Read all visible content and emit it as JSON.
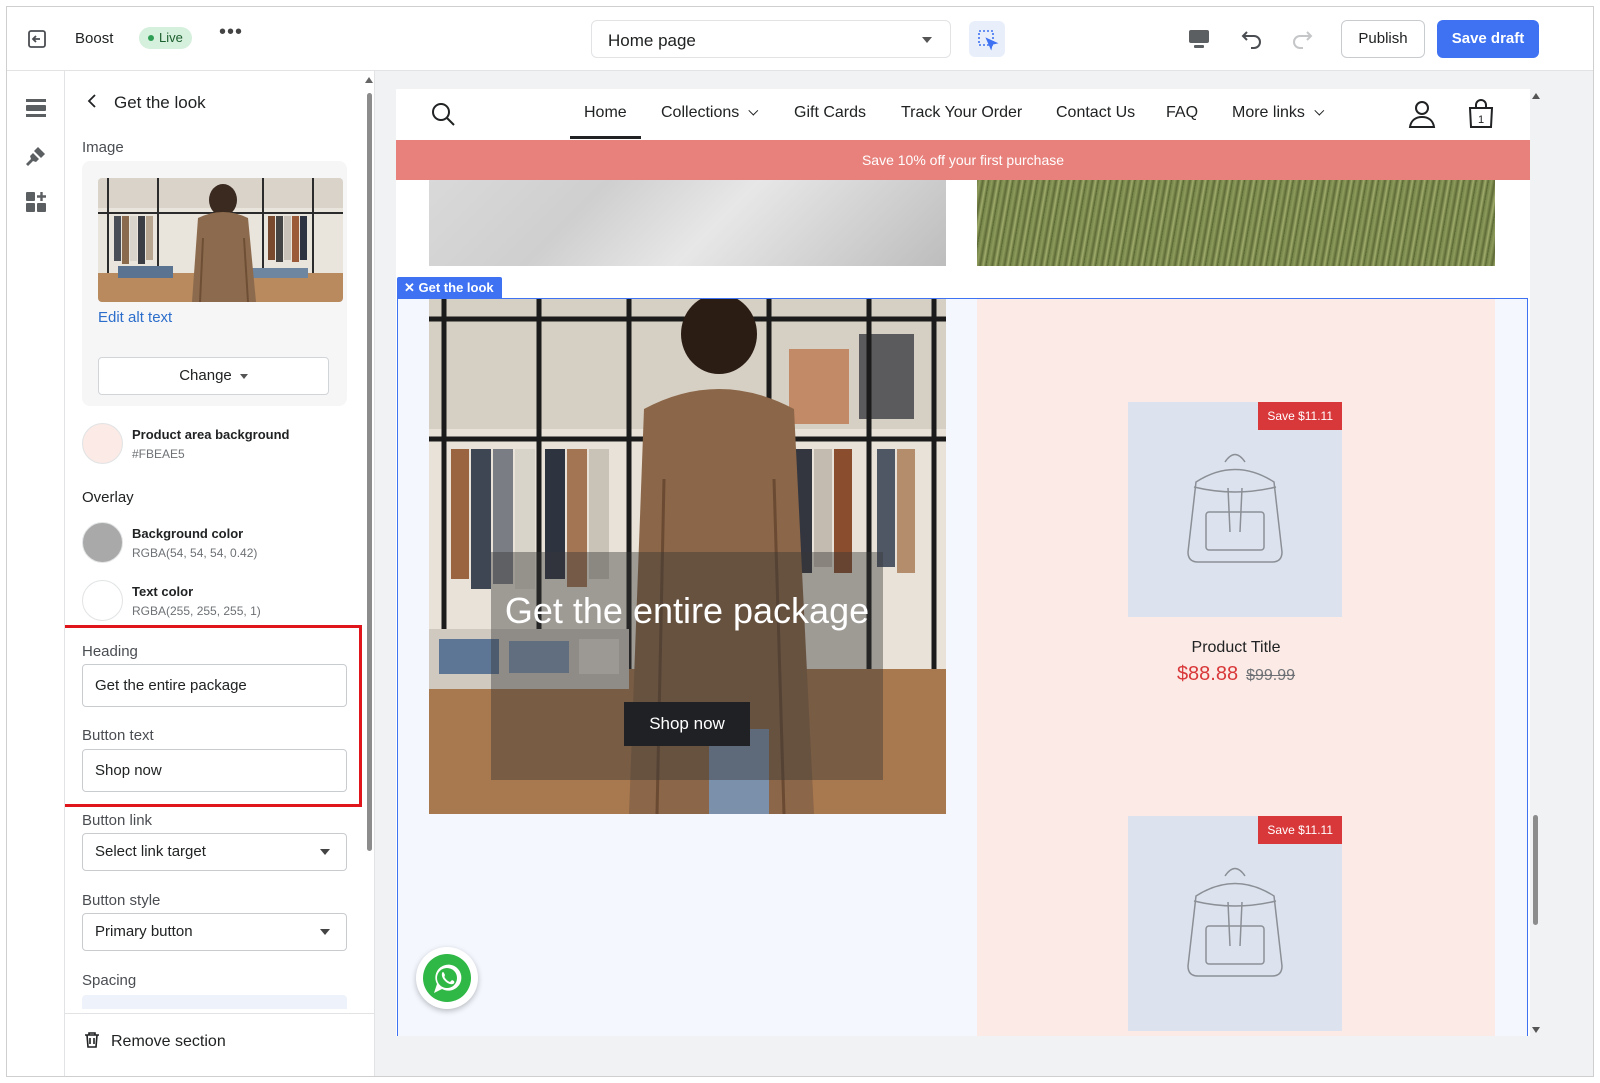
{
  "topbar": {
    "theme_name": "Boost",
    "status_badge": "Live",
    "more_label": "•••",
    "page_selector": "Home page",
    "publish_label": "Publish",
    "save_draft_label": "Save draft"
  },
  "rail": {
    "icons": [
      "sections-icon",
      "theme-settings-icon",
      "app-blocks-icon"
    ]
  },
  "panel": {
    "title": "Get the look",
    "image_label": "Image",
    "edit_alt_text": "Edit alt text",
    "change_label": "Change",
    "product_area_background": {
      "label": "Product area background",
      "value": "#FBEAE5",
      "color": "#FBEAE5"
    },
    "overlay_heading": "Overlay",
    "background_color": {
      "label": "Background color",
      "value": "RGBA(54, 54, 54, 0.42)",
      "color": "#a9a9a9"
    },
    "text_color": {
      "label": "Text color",
      "value": "RGBA(255, 255, 255, 1)",
      "color": "#ffffff"
    },
    "heading": {
      "label": "Heading",
      "value": "Get the entire package"
    },
    "button_text": {
      "label": "Button text",
      "value": "Shop now"
    },
    "button_link": {
      "label": "Button link",
      "value": "Select link target"
    },
    "button_style": {
      "label": "Button style",
      "value": "Primary button"
    },
    "spacing_label": "Spacing",
    "remove_section": "Remove section"
  },
  "preview": {
    "nav": {
      "items": [
        {
          "label": "Home",
          "active": true,
          "dropdown": false
        },
        {
          "label": "Collections",
          "active": false,
          "dropdown": true
        },
        {
          "label": "Gift Cards",
          "active": false,
          "dropdown": false
        },
        {
          "label": "Track Your Order",
          "active": false,
          "dropdown": false
        },
        {
          "label": "Contact Us",
          "active": false,
          "dropdown": false
        },
        {
          "label": "FAQ",
          "active": false,
          "dropdown": false
        },
        {
          "label": "More links",
          "active": false,
          "dropdown": true
        }
      ],
      "cart_count": "1"
    },
    "announcement": "Save 10% off your first purchase",
    "selected_section_tag": "Get the look",
    "look": {
      "heading": "Get the entire package",
      "button": "Shop now"
    },
    "products": [
      {
        "badge": "Save $11.11",
        "title": "Product Title",
        "price": "$88.88",
        "compare_at": "$99.99"
      },
      {
        "badge": "Save $11.11"
      }
    ]
  },
  "colors": {
    "accent": "#3e72f2",
    "announcement_bg": "#e8817c",
    "sale_red": "#d9383a",
    "highlight_red": "#e0151c"
  }
}
